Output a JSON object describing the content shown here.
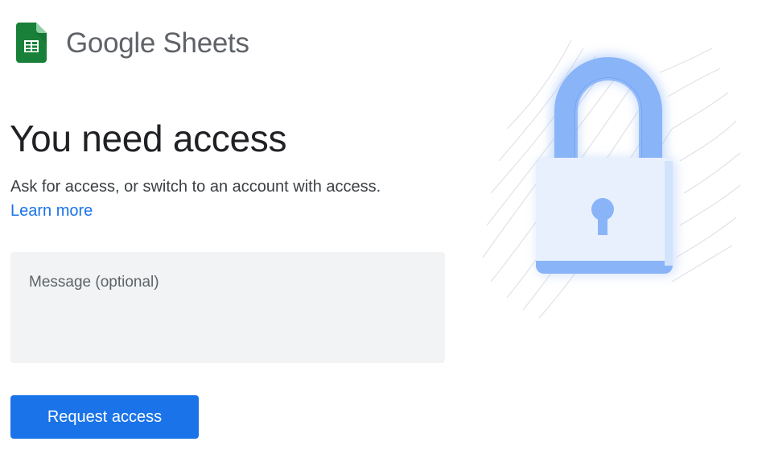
{
  "brand": {
    "app_name": "Google Sheets",
    "logo_icon": "sheets-logo-icon",
    "logo_color": "#188038"
  },
  "main": {
    "title": "You need access",
    "subtitle": "Ask for access, or switch to an account with access.",
    "learn_more": "Learn more"
  },
  "message": {
    "placeholder": "Message (optional)",
    "value": ""
  },
  "actions": {
    "request_label": "Request access"
  },
  "illustration": {
    "icon": "padlock-icon",
    "colors": {
      "shackle": "#8ab4f8",
      "body": "#e8f0fe",
      "keyhole": "#8ab4f8",
      "accent": "#1a73e8"
    }
  }
}
